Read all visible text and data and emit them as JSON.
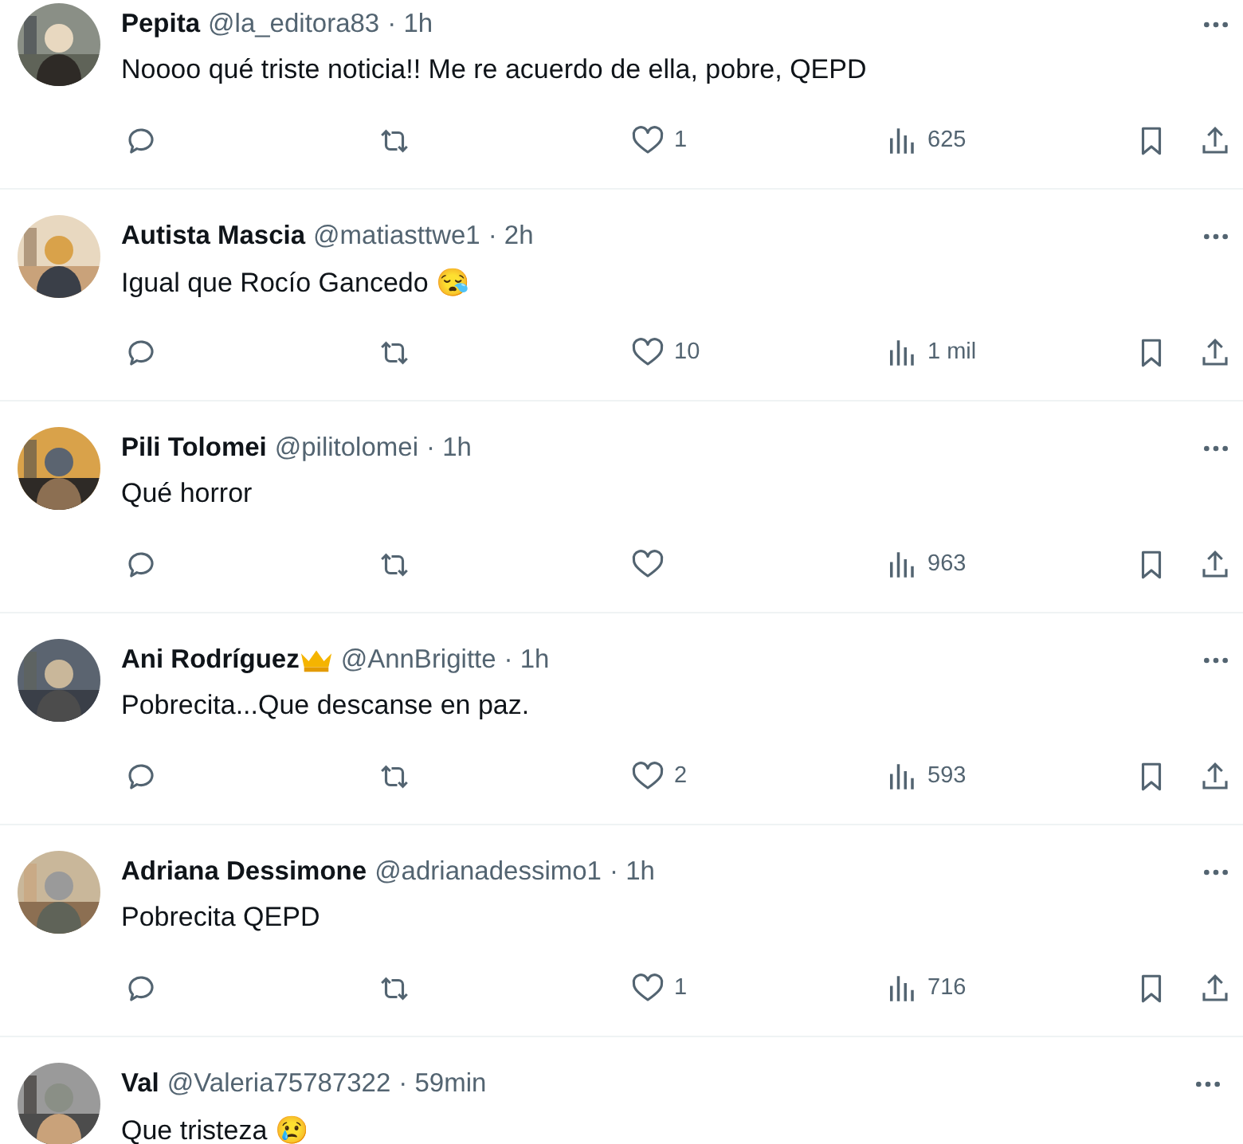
{
  "replies": [
    {
      "name": "Pepita",
      "handle": "@la_editora83",
      "time": "· 1h",
      "text": "Noooo qué triste noticia!! Me re acuerdo de ella, pobre, QEPD",
      "likes": "1",
      "views": "625"
    },
    {
      "name": "Autista Mascia",
      "handle": "@matiasttwe1",
      "time": "· 2h",
      "text": "Igual que Rocío Gancedo 😪",
      "likes": "10",
      "views": "1 mil"
    },
    {
      "name": "Pili Tolomei",
      "handle": "@pilitolomei",
      "time": "· 1h",
      "text": "Qué horror",
      "views": "963"
    },
    {
      "name": "Ani Rodríguez",
      "badge": true,
      "handle": "@AnnBrigitte",
      "time": "· 1h",
      "text": "Pobrecita...Que descanse en paz.",
      "likes": "2",
      "views": "593"
    },
    {
      "name": "Adriana Dessimone",
      "handle": "@adrianadessimo1",
      "time": "· 1h",
      "text": "Pobrecita QEPD",
      "likes": "1",
      "views": "716"
    },
    {
      "name": "Val",
      "handle": "@Valeria75787322",
      "time": "· 59min",
      "text": "Que tristeza 😢"
    }
  ]
}
